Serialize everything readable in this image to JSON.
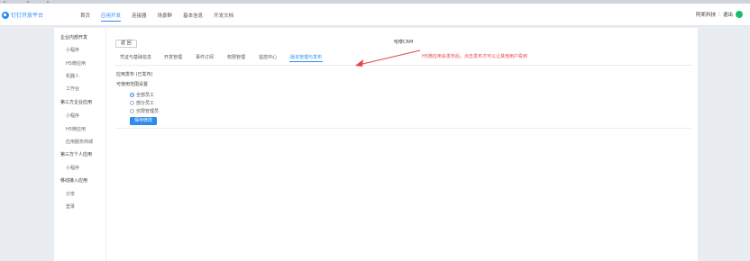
{
  "header": {
    "logo_text": "钉钉开放平台",
    "nav": [
      {
        "label": "首页"
      },
      {
        "label": "应用开发"
      },
      {
        "label": "连接器"
      },
      {
        "label": "场景群"
      },
      {
        "label": "基本信息"
      },
      {
        "label": "开发文档"
      }
    ],
    "user_company": "阿凯科技",
    "separator": "|",
    "logout_label": "退出"
  },
  "sidebar": {
    "groups": [
      {
        "label": "企业内部开发",
        "items": [
          "小程序",
          "H5微应用",
          "机器人",
          "工作台"
        ]
      },
      {
        "label": "第三方企业应用",
        "items": [
          "小程序",
          "H5微应用",
          "应用服务商城"
        ]
      },
      {
        "label": "第三方个人应用",
        "items": [
          "小程序"
        ]
      },
      {
        "label": "移动接入应用",
        "items": [
          "分享",
          "登录"
        ]
      }
    ]
  },
  "page": {
    "back_label": "返 回",
    "app_name": "哈喽CRM",
    "tabs": [
      {
        "label": "凭证与基础信息"
      },
      {
        "label": "开发管理"
      },
      {
        "label": "事件订阅"
      },
      {
        "label": "权限管理"
      },
      {
        "label": "监控中心"
      },
      {
        "label": "版本管理与发布"
      }
    ],
    "note": "H5微应用会发布后，点击发布才可以让其他用户看到",
    "release_status": "应用发布 (已发布)",
    "scope_title": "可使用范围设置",
    "scope_options": [
      {
        "label": "全部员工",
        "selected": true
      },
      {
        "label": "部分员工",
        "selected": false
      },
      {
        "label": "仅限管理员",
        "selected": false
      }
    ],
    "save_label": "保存修改"
  },
  "colors": {
    "accent": "#2d8cf0",
    "note": "#e64545",
    "user_avatar": "#19be6b"
  }
}
